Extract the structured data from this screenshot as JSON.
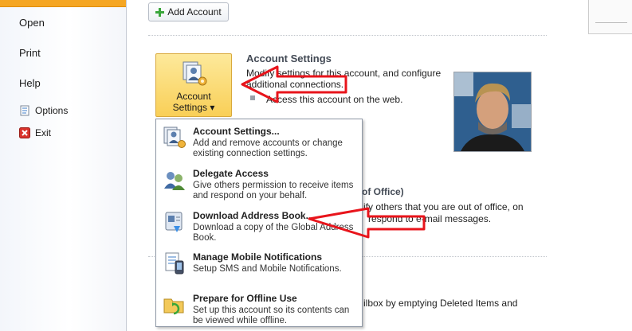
{
  "nav": {
    "open": "Open",
    "print": "Print",
    "help": "Help",
    "options": "Options",
    "exit": "Exit"
  },
  "add_account": {
    "label": "Add Account"
  },
  "account_settings_button": {
    "line1": "Account",
    "line2": "Settings ▾"
  },
  "section": {
    "title": "Account Settings",
    "desc_line1": "Modify settings for this account, and configure",
    "desc_line2": "additional connections.",
    "link": "Access this account on the web."
  },
  "ooo": {
    "title_partial": "of Office)",
    "desc_line1": "ify others that you are out of office, on",
    "desc_line2": "respond to e-mail messages."
  },
  "mailbox": {
    "text_partial": "ilbox by emptying Deleted Items and"
  },
  "menu": {
    "items": [
      {
        "title": "Account Settings...",
        "desc": "Add and remove accounts or change existing connection settings.",
        "icon": "account-settings-icon"
      },
      {
        "title": "Delegate Access",
        "desc": "Give others permission to receive items and respond on your behalf.",
        "icon": "delegate-icon"
      },
      {
        "title": "Download Address Book...",
        "desc": "Download a copy of the Global Address Book.",
        "icon": "address-book-icon"
      },
      {
        "title": "Manage Mobile Notifications",
        "desc": "Setup SMS and Mobile Notifications.",
        "icon": "mobile-icon"
      },
      {
        "title": "Prepare for Offline Use",
        "desc": "Set up this account so its contents can be viewed while offline.",
        "icon": "offline-icon"
      }
    ]
  },
  "colors": {
    "accent_orange": "#f5a623",
    "button_yellow": "#f9cf57",
    "annotation_red": "#e8141b"
  }
}
